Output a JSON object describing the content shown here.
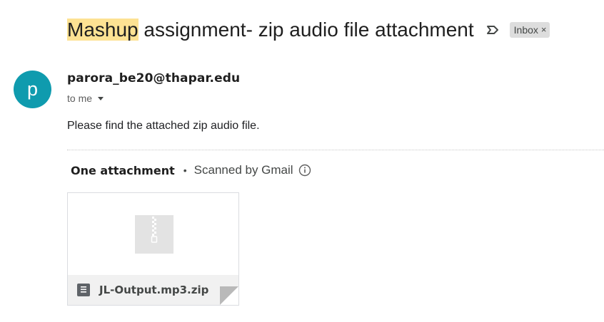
{
  "subject": {
    "highlight": "Mashup",
    "rest": " assignment- zip audio file attachment"
  },
  "labels": {
    "inbox": "Inbox",
    "remove": "×"
  },
  "message": {
    "avatar_letter": "p",
    "sender": "parora_be20@thapar.edu",
    "to": "to me",
    "body": "Please find the attached zip audio file."
  },
  "attachments": {
    "count_label": "One attachment",
    "separator": "•",
    "scanned_label": "Scanned by Gmail",
    "file_name": "JL-Output.mp3.zip",
    "icons": [
      "importance-icon",
      "info-icon",
      "zip-file-icon",
      "zip-thumbnail-icon"
    ]
  },
  "colors": {
    "avatar_bg": "#0f9bae",
    "highlight": "#fde293",
    "chip_bg": "#dddddd"
  }
}
